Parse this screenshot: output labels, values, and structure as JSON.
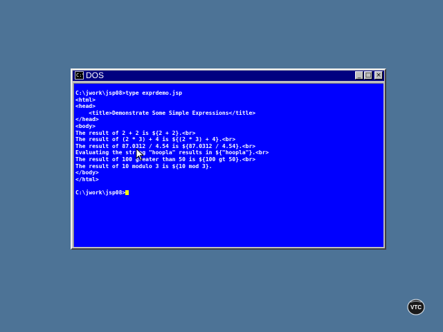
{
  "window": {
    "title": "DOS",
    "icon_label": "C:\\",
    "minimize_icon": "minimize-icon",
    "maximize_icon": "maximize-icon",
    "close_icon": "close-icon",
    "minimize_glyph": "_",
    "maximize_glyph": "□",
    "close_glyph": "×"
  },
  "console": {
    "lines": [
      "C:\\jwork\\jsp08>type exprdemo.jsp",
      "<html>",
      "<head>",
      "    <title>Demonstrate Some Simple Expressions</title>",
      "</head>",
      "<body>",
      "The result of 2 + 2 is ${2 + 2}.<br>",
      "The result of (2 * 3) + 4 is ${(2 * 3) + 4}.<br>",
      "The result of 87.0312 / 4.54 is ${87.0312 / 4.54}.<br>",
      "Evaluating the string \"hoopla\" results in ${\"hoopla\"}.<br>",
      "The result of 100 greater than 50 is ${100 gt 50}.<br>",
      "The result of 10 modulo 3 is ${10 mod 3}.",
      "</body>",
      "</html>",
      "",
      "C:\\jwork\\jsp08>"
    ]
  },
  "colors": {
    "desktop": "#4d7396",
    "console_bg": "#0000ff",
    "console_text": "#ffffff",
    "cursor": "#ffff00",
    "titlebar": "#000080"
  },
  "logo": {
    "text": "VTC",
    "icon": "vtc-logo-icon"
  },
  "pointer": {
    "icon": "mouse-pointer-icon"
  }
}
